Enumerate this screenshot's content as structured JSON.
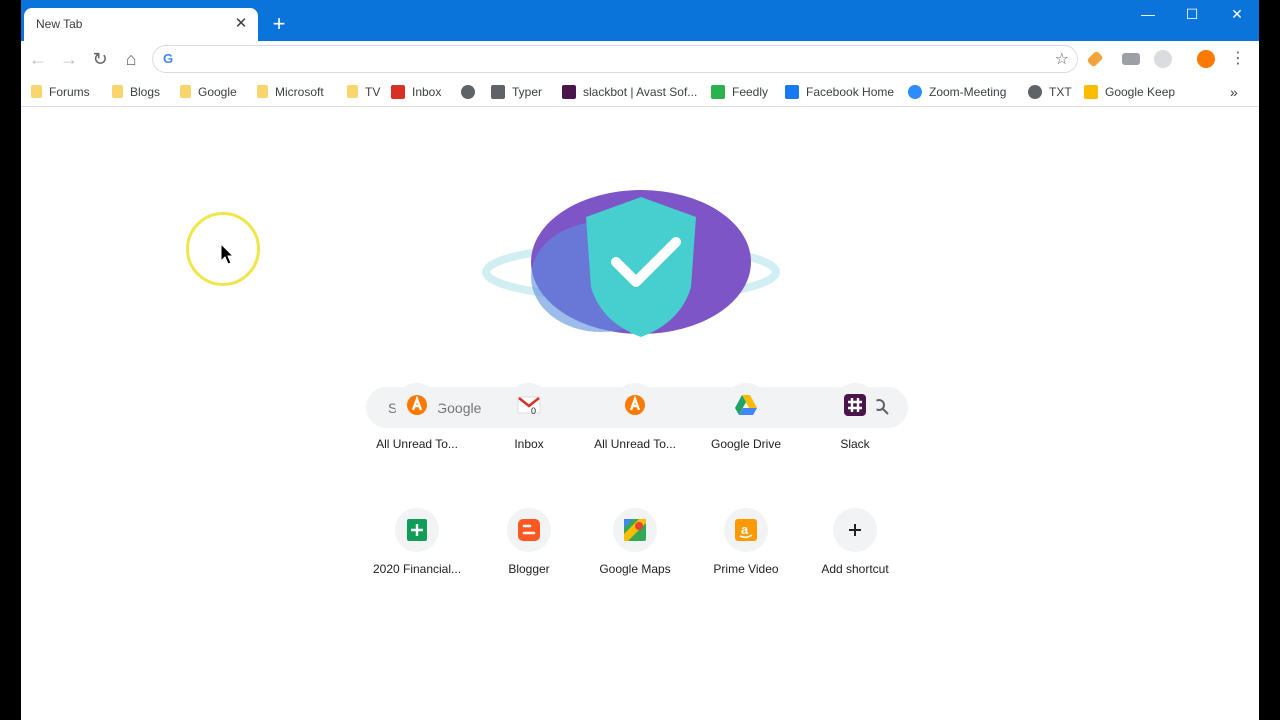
{
  "tab": {
    "title": "New Tab"
  },
  "omnibox": {
    "value": "",
    "placeholder": ""
  },
  "bookmarks": [
    {
      "label": "Forums",
      "icon": "folder-icon"
    },
    {
      "label": "Blogs",
      "icon": "folder-icon"
    },
    {
      "label": "Google",
      "icon": "folder-icon"
    },
    {
      "label": "Microsoft",
      "icon": "folder-icon"
    },
    {
      "label": "TV",
      "icon": "folder-icon"
    },
    {
      "label": "Inbox",
      "icon": "gmail-icon"
    },
    {
      "label": "",
      "icon": "globe-icon"
    },
    {
      "label": "Typer",
      "icon": "typer-icon"
    },
    {
      "label": "slackbot | Avast Sof...",
      "icon": "slack-icon"
    },
    {
      "label": "Feedly",
      "icon": "feedly-icon"
    },
    {
      "label": "Facebook Home",
      "icon": "facebook-icon"
    },
    {
      "label": "Zoom-Meeting",
      "icon": "zoom-icon"
    },
    {
      "label": "TXT",
      "icon": "globe-icon"
    },
    {
      "label": "Google Keep",
      "icon": "keep-icon"
    }
  ],
  "search": {
    "placeholder": "Search Google"
  },
  "shortcuts": [
    {
      "label": "All Unread To...",
      "icon": "avast-icon"
    },
    {
      "label": "Inbox",
      "icon": "gmail-icon"
    },
    {
      "label": "All Unread To...",
      "icon": "avast-icon"
    },
    {
      "label": "Google Drive",
      "icon": "drive-icon"
    },
    {
      "label": "Slack",
      "icon": "slack-icon"
    },
    {
      "label": "2020 Financial...",
      "icon": "sheets-icon"
    },
    {
      "label": "Blogger",
      "icon": "blogger-icon"
    },
    {
      "label": "Google Maps",
      "icon": "maps-icon"
    },
    {
      "label": "Prime Video",
      "icon": "amazon-icon"
    },
    {
      "label": "Add shortcut",
      "icon": "plus-icon"
    }
  ],
  "colors": {
    "titlebar": "#0a74da",
    "avast": "#ff7800"
  }
}
